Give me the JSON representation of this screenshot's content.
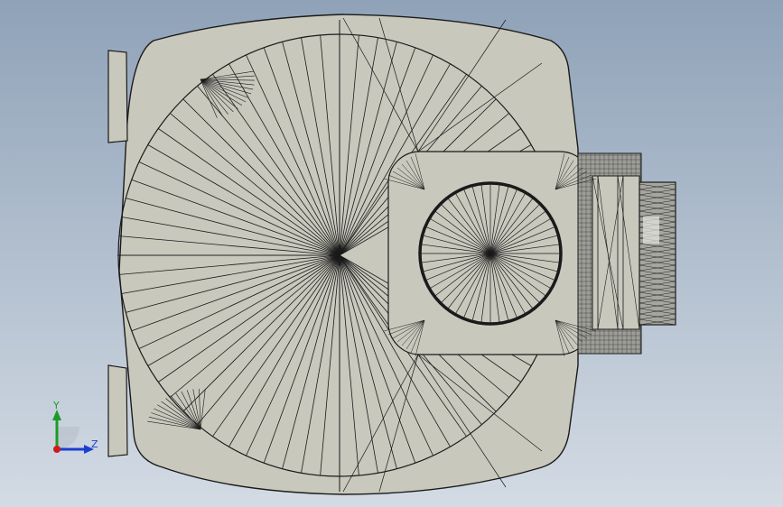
{
  "viewport": {
    "background_top": "#8fa2b8",
    "background_bottom": "#d3dbe4"
  },
  "model": {
    "view": "wireframe-shaded",
    "face_color": "#c9c8bd",
    "edge_color": "#1a1a1a"
  },
  "triad": {
    "y_label": "Y",
    "z_label": "Z",
    "y_color": "#1f9a2a",
    "z_color": "#1a3fd0",
    "x_color": "#d11b1b"
  }
}
